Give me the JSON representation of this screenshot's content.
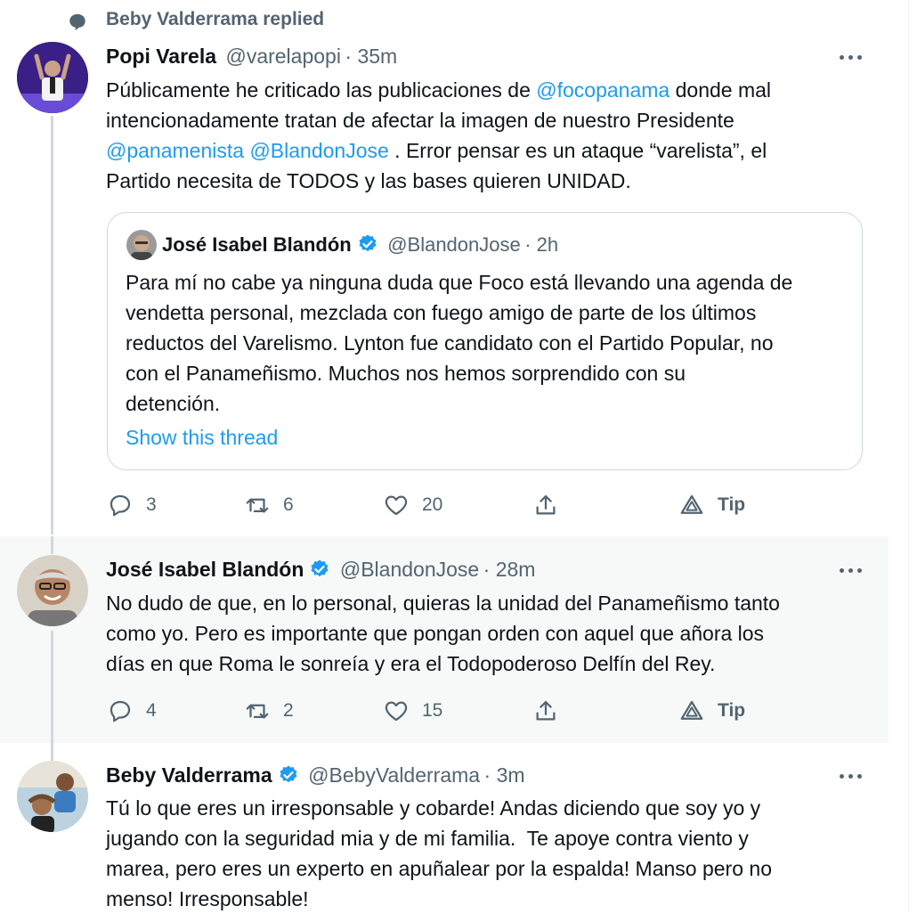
{
  "context": {
    "text": "Beby Valderrama replied",
    "icon": "reply-bubble-icon"
  },
  "tweets": [
    {
      "author": "Popi Varela",
      "handle": "@varelapopi",
      "time": "· 35m",
      "text_lines": [
        [
          "Públicamente he criticado las publicaciones de ",
          "@focopanama",
          " donde mal"
        ],
        [
          "intencionadamente tratan de afectar la imagen de nuestro Presidente"
        ],
        [
          "@panamenista",
          " ",
          "@BlandonJose",
          " . Error pensar es un ataque “varelista”, el"
        ],
        [
          "Partido necesita de TODOS y las bases quieren UNIDAD."
        ]
      ],
      "quote": {
        "author": "José Isabel Blandón",
        "handle": "@BlandonJose",
        "time": "· 2h",
        "lines": [
          "Para mí no cabe ya ninguna duda que Foco está llevando una agenda de",
          "vendetta personal, mezclada con fuego amigo de parte de los últimos",
          "reductos del Varelismo. Lynton fue candidato con el Partido Popular, no",
          "con el Panameñismo. Muchos nos hemos sorprendido con su",
          "detención."
        ],
        "show_thread": "Show this thread"
      },
      "actions": {
        "replies": "3",
        "retweets": "6",
        "likes": "20",
        "tip": "Tip"
      }
    },
    {
      "author": "José Isabel Blandón",
      "handle": "@BlandonJose",
      "time": "· 28m",
      "lines": [
        "No dudo de que, en lo personal, quieras la unidad del Panameñismo tanto",
        "como yo. Pero es importante que pongan orden con aquel que añora los",
        "días en que Roma le sonreía y era el Todopoderoso Delfín del Rey."
      ],
      "actions": {
        "replies": "4",
        "retweets": "2",
        "likes": "15",
        "tip": "Tip"
      }
    },
    {
      "author": "Beby Valderrama",
      "handle": "@BebyValderrama",
      "time": "· 3m",
      "lines": [
        "Tú lo que eres un irresponsable y cobarde! Andas diciendo que soy yo y",
        "jugando con la seguridad mia y de mi familia.  Te apoye contra viento y",
        "marea, pero eres un experto en apuñalear por la espalda! Manso pero no",
        "menso! Irresponsable!"
      ]
    }
  ],
  "colors": {
    "accent": "#1d9bf0",
    "secondary_text": "#536471",
    "hover_bg": "#f7f9f9"
  }
}
